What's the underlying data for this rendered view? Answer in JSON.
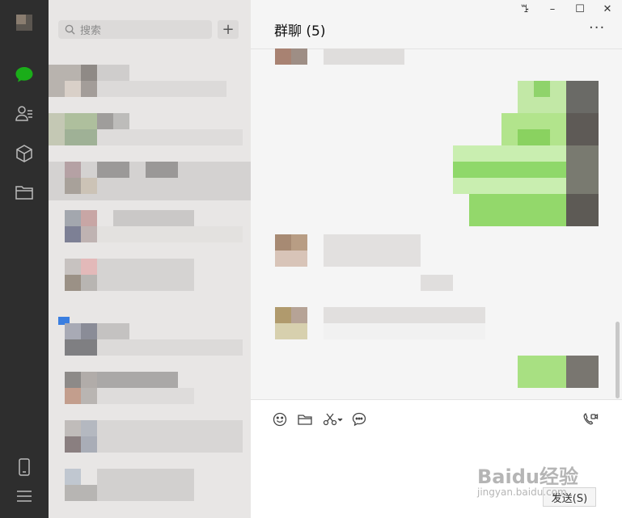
{
  "search": {
    "placeholder": "搜索"
  },
  "add_button": {
    "label": "+"
  },
  "chat": {
    "title": "群聊 (5)"
  },
  "window": {
    "pin": "ꔤ",
    "minimize": "–",
    "maximize": "☐",
    "close": "✕",
    "more": "···"
  },
  "composer": {
    "send_label": "发送(S)"
  },
  "watermark": {
    "brand": "Baidu经验",
    "url": "jingyan.baidu.com"
  },
  "colors": {
    "sidebar": "#2e2e2e",
    "accent": "#1aad19",
    "bubble_self": "#9eea6a",
    "list_bg": "#e8e6e5"
  },
  "icons": [
    "chat-icon",
    "contacts-icon",
    "favorites-icon",
    "files-icon",
    "phone-icon",
    "menu-icon",
    "search-icon",
    "emoji-icon",
    "folder-icon",
    "scissors-icon",
    "chat-history-icon",
    "video-call-icon"
  ]
}
